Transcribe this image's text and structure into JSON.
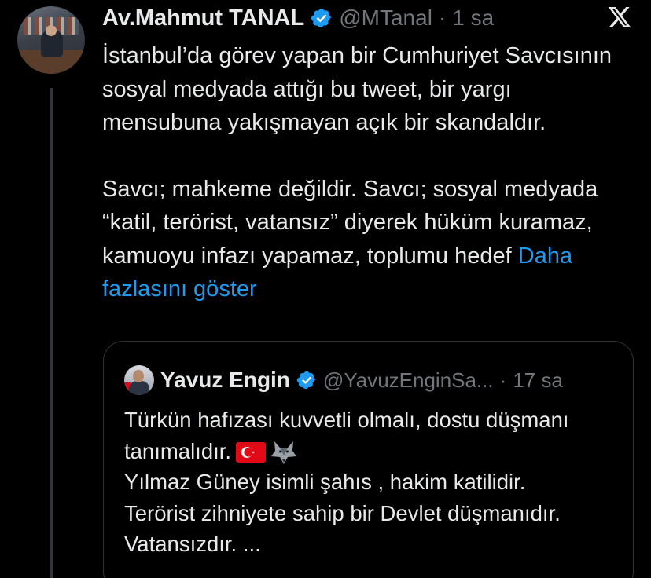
{
  "author": {
    "name": "Av.Mahmut TANAL",
    "handle": "@MTanal",
    "separator": "·",
    "time": "1 sa",
    "verified_color": "#1d9bf0"
  },
  "tweet": {
    "paragraph1": "İstanbul’da görev yapan bir Cumhuriyet Savcısının sosyal medyada attığı bu tweet, bir yargı mensubuna yakışmayan açık bir skandaldır.",
    "paragraph2": "Savcı; mahkeme değildir. Savcı; sosyal medyada “katil, terörist, vatansız” diyerek hüküm kuramaz, kamuoyu infazı yapamaz, toplumu hedef",
    "show_more": "Daha fazlasını göster"
  },
  "quote": {
    "name": "Yavuz Engin",
    "handle": "@YavuzEnginSa...",
    "separator": "·",
    "time": "17 sa",
    "line1": "Türkün hafızası kuvvetli olmalı, dostu düşmanı tanımalıdır.",
    "line2": "Yılmaz Güney isimli şahıs , hakim katilidir.",
    "line3": "Terörist  zihniyete sahip bir Devlet düşmanıdır. Vatansızdır. ...",
    "emojis": [
      "turkish-flag-icon",
      "wolf-icon"
    ]
  },
  "icons": {
    "close": "x-logo-icon",
    "verified": "verified-badge-icon"
  },
  "colors": {
    "background": "#000000",
    "text": "#e7e9ea",
    "muted": "#71767b",
    "link": "#1d9bf0",
    "border": "#2f3336"
  }
}
